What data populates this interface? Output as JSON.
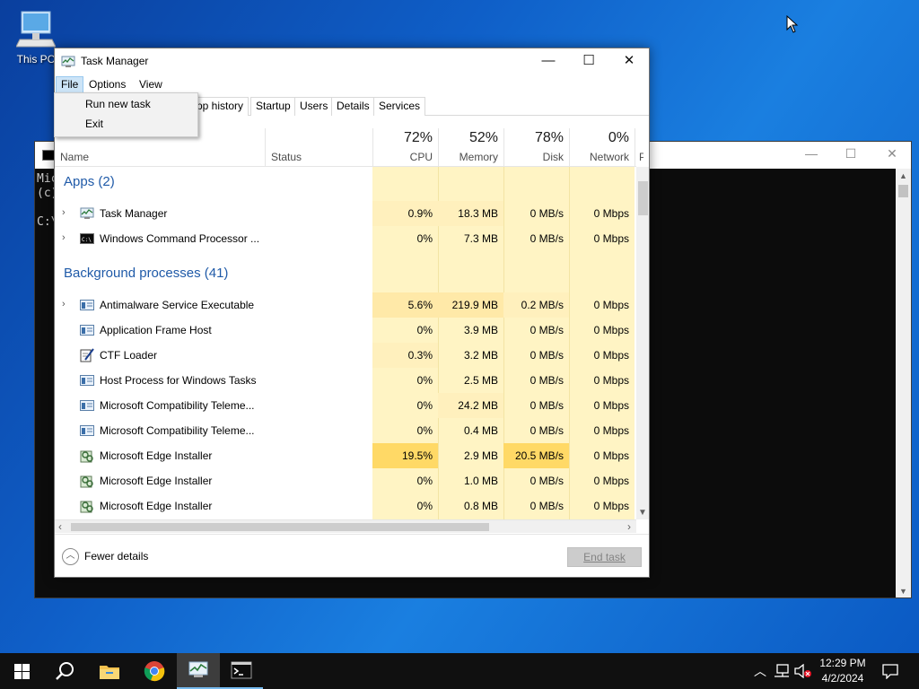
{
  "desktop": {
    "icons": [
      {
        "label": "This PC",
        "icon": "this-pc-icon"
      }
    ]
  },
  "cmd_window": {
    "lines": [
      "Mic",
      "(c)",
      "",
      "C:\\"
    ]
  },
  "task_manager": {
    "title": "Task Manager",
    "title_icon": "task-manager-icon",
    "controls": {
      "minimize": "—",
      "maximize": "☐",
      "close": "✕"
    },
    "menu": [
      "File",
      "Options",
      "View"
    ],
    "file_menu_items": [
      "Run new task",
      "Exit"
    ],
    "tabs": [
      "pp history",
      "Startup",
      "Users",
      "Details",
      "Services"
    ],
    "columns": {
      "name": "Name",
      "status": "Status",
      "cpu": {
        "pct": "72%",
        "label": "CPU"
      },
      "memory": {
        "pct": "52%",
        "label": "Memory"
      },
      "disk": {
        "pct": "78%",
        "label": "Disk"
      },
      "network": {
        "pct": "0%",
        "label": "Network"
      },
      "extra": "P"
    },
    "groups": {
      "apps": "Apps (2)",
      "background": "Background processes (41)"
    },
    "apps": [
      {
        "name": "Task Manager",
        "icon": "task-manager-icon",
        "expandable": true,
        "cpu": "0.9%",
        "memory": "18.3 MB",
        "disk": "0 MB/s",
        "network": "0 Mbps"
      },
      {
        "name": "Windows Command Processor ...",
        "icon": "cmd-icon",
        "expandable": true,
        "cpu": "0%",
        "memory": "7.3 MB",
        "disk": "0 MB/s",
        "network": "0 Mbps"
      }
    ],
    "background": [
      {
        "name": "Antimalware Service Executable",
        "icon": "service-icon",
        "expandable": true,
        "cpu": "5.6%",
        "memory": "219.9 MB",
        "disk": "0.2 MB/s",
        "network": "0 Mbps"
      },
      {
        "name": "Application Frame Host",
        "icon": "service-icon",
        "expandable": false,
        "cpu": "0%",
        "memory": "3.9 MB",
        "disk": "0 MB/s",
        "network": "0 Mbps"
      },
      {
        "name": "CTF Loader",
        "icon": "notepad-pen-icon",
        "expandable": false,
        "cpu": "0.3%",
        "memory": "3.2 MB",
        "disk": "0 MB/s",
        "network": "0 Mbps"
      },
      {
        "name": "Host Process for Windows Tasks",
        "icon": "service-icon",
        "expandable": false,
        "cpu": "0%",
        "memory": "2.5 MB",
        "disk": "0 MB/s",
        "network": "0 Mbps"
      },
      {
        "name": "Microsoft Compatibility Teleme...",
        "icon": "service-icon",
        "expandable": false,
        "cpu": "0%",
        "memory": "24.2 MB",
        "disk": "0 MB/s",
        "network": "0 Mbps"
      },
      {
        "name": "Microsoft Compatibility Teleme...",
        "icon": "service-icon",
        "expandable": false,
        "cpu": "0%",
        "memory": "0.4 MB",
        "disk": "0 MB/s",
        "network": "0 Mbps"
      },
      {
        "name": "Microsoft Edge Installer",
        "icon": "installer-icon",
        "expandable": false,
        "cpu": "19.5%",
        "memory": "2.9 MB",
        "disk": "20.5 MB/s",
        "network": "0 Mbps"
      },
      {
        "name": "Microsoft Edge Installer",
        "icon": "installer-icon",
        "expandable": false,
        "cpu": "0%",
        "memory": "1.0 MB",
        "disk": "0 MB/s",
        "network": "0 Mbps"
      },
      {
        "name": "Microsoft Edge Installer",
        "icon": "installer-icon",
        "expandable": false,
        "cpu": "0%",
        "memory": "0.8 MB",
        "disk": "0 MB/s",
        "network": "0 Mbps"
      }
    ],
    "footer": {
      "fewer_details": "Fewer details",
      "end_task": "End task"
    }
  },
  "taskbar": {
    "items": [
      "start-icon",
      "search-icon",
      "file-explorer-icon",
      "chrome-icon",
      "task-manager-icon",
      "cmd-icon"
    ],
    "active_item": "task-manager-icon",
    "tray": [
      "chevron-up-icon",
      "network-icon",
      "volume-muted-icon"
    ],
    "time": "12:29 PM",
    "date": "4/2/2024",
    "notifications_icon": "notification-icon"
  },
  "colors": {
    "heat_light": "#fff4c4",
    "heat_hot": "#ffd966",
    "group_title": "#1f5aa8",
    "taskbar": "#101010"
  }
}
